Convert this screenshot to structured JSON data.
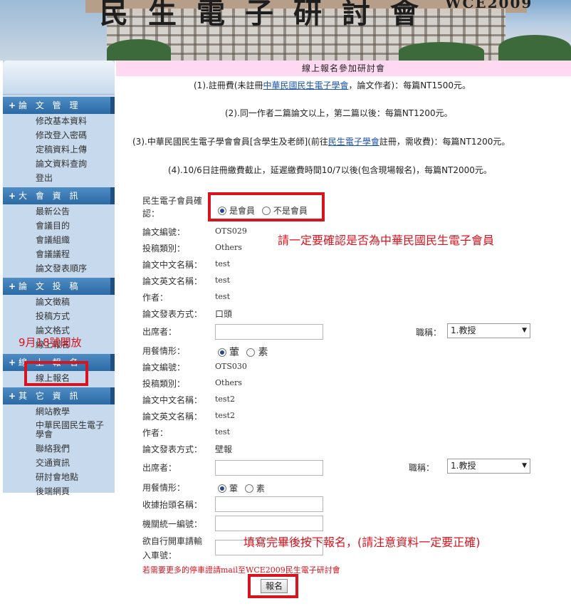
{
  "banner": {
    "title_glyphs": "民生電子研討會",
    "wce": "WCE2009"
  },
  "sidebar": {
    "sections": [
      {
        "title": "論 文 管 理",
        "items": [
          "修改基本資料",
          "修改登入密碼",
          "定稿資料上傳",
          "論文資料查詢",
          "登出"
        ]
      },
      {
        "title": "大 會 資 訊",
        "items": [
          "最新公告",
          "會議目的",
          "會議組織",
          "會議議程",
          "論文發表順序"
        ]
      },
      {
        "title": "論 文 投 稿",
        "items": [
          "論文徵稿",
          "投稿方式",
          "論文格式",
          "線上報名"
        ]
      },
      {
        "title": "線 上 報 名",
        "items": [
          "線上報名"
        ]
      },
      {
        "title": "其 它 資 訊",
        "items": [
          "網站教學",
          "中華民國民生電子學會",
          "聯絡我們",
          "交通資訊",
          "研討會地點",
          "後端網頁"
        ]
      }
    ],
    "overlay_note": "9月18號開放"
  },
  "main": {
    "heading": "線上報名參加研討會",
    "notes": {
      "n1_pre": "(1).註冊費(未註冊",
      "n1_link": "中華民國民生電子學會",
      "n1_post": "，論文作者)：每篇NT1500元。",
      "n2": "(2).同一作者二篇論文以上，第二篇以後：每篇NT1200元。",
      "n3_pre": "(3).中華民國民生電子學會會員[含學生及老師](前往",
      "n3_link": "民生電子學會",
      "n3_post": "註冊，需收費)：每篇NT1200元。",
      "n4": "(4).10/6日註冊繳費截止，延遲繳費時間10/7以後(包含現場報名)，每篇NT2000元。"
    },
    "member": {
      "label_line1": "民生電子會員確",
      "label_line2": "認：",
      "opt_yes": "是會員",
      "opt_no": "不是會員"
    },
    "labels": {
      "paper_id": "論文編號：",
      "category": "投稿類別：",
      "title_zh": "論文中文名稱：",
      "title_en": "論文英文名稱：",
      "author": "作者：",
      "present": "論文發表方式：",
      "attendee": "出席者：",
      "rank": "職稱：",
      "meal": "用餐情形：",
      "receipt": "收據抬頭名稱：",
      "org_id": "機關統一編號：",
      "car_line1": "欲自行開車請輸",
      "car_line2": "入車號："
    },
    "papers": [
      {
        "id": "OTS029",
        "category": "Others",
        "title_zh": "test",
        "title_en": "test",
        "author": "test",
        "present": "口頭",
        "rank": "1.教授",
        "meal_a": "葷",
        "meal_b": "素"
      },
      {
        "id": "OTS030",
        "category": "Others",
        "title_zh": "test2",
        "title_en": "test2",
        "author": "test",
        "present": "壁報",
        "rank": "1.教授",
        "meal_a": "葷",
        "meal_b": "素"
      }
    ],
    "parking_note": "若需要更多的停車證請mail至WCE2009民生電子研討會",
    "submit_label": "報名"
  },
  "annotations": {
    "member_note": "請一定要確認是否為中華民國民生電子會員",
    "submit_note": "填寫完畢後按下報名，(請注意資料一定要正確)"
  },
  "colors": {
    "accent_red": "#d8141f",
    "heading_bg": "#ffd9f2",
    "sidebar_bg": "#c7d9ec",
    "section_head": "#2b6aa5"
  }
}
